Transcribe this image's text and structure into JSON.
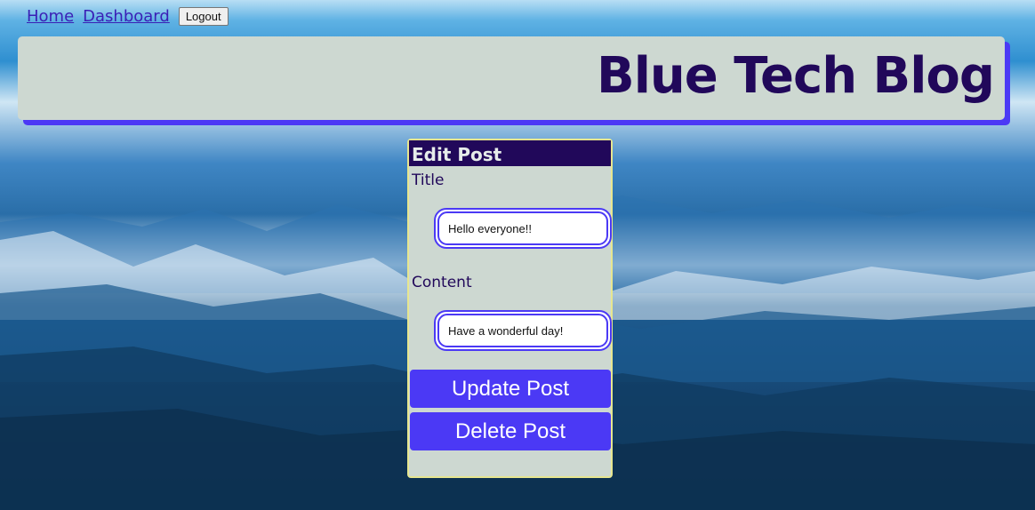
{
  "nav": {
    "home_label": "Home",
    "dashboard_label": "Dashboard",
    "logout_label": "Logout"
  },
  "header": {
    "title": "Blue Tech Blog"
  },
  "edit_post": {
    "heading": "Edit Post",
    "title_label": "Title",
    "title_value": "Hello everyone!!",
    "content_label": "Content",
    "content_value": "Have a wonderful day!",
    "update_button": "Update Post",
    "delete_button": "Delete Post"
  },
  "colors": {
    "accent": "#4b39f5",
    "header_text": "#21085a",
    "panel_bg": "#cdd8d1",
    "card_border": "#e6e690"
  }
}
